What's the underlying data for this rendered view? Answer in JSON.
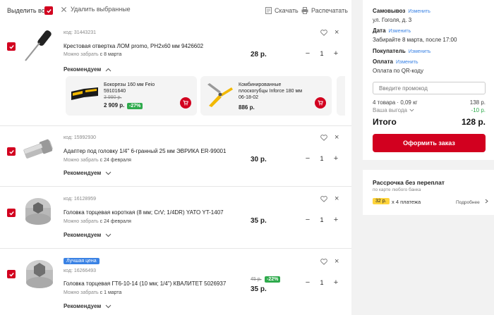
{
  "toolbar": {
    "select_all": "Выделить все",
    "delete_selected": "Удалить выбранные",
    "download": "Скачать",
    "print": "Распечатать"
  },
  "items": [
    {
      "code": "код: 31443231",
      "name": "Крестовая отвертка ЛОМ promo, PH2x60 мм 9426602",
      "pickup_prefix": "Можно забрать",
      "pickup_date": "с 8 марта",
      "price": "28 р.",
      "qty": "1",
      "recommend": "Рекомендуем"
    },
    {
      "code": "код: 15992930",
      "name": "Адаптер под головку 1/4\" 6-гранный 25 мм ЭВРИКА ER-99001",
      "pickup_prefix": "Можно забрать",
      "pickup_date": "с 24 февраля",
      "price": "30 р.",
      "qty": "1",
      "recommend": "Рекомендуем"
    },
    {
      "code": "код: 16128959",
      "name": "Головка торцевая короткая (8 мм; CrV; 1/4DR) YATO YT-1407",
      "pickup_prefix": "Можно забрать",
      "pickup_date": "с 24 февраля",
      "price": "35 р.",
      "qty": "1",
      "recommend": "Рекомендуем"
    },
    {
      "badge": "Лучшая цена",
      "code": "код: 16266493",
      "name": "Головка торцевая ГТ6-10-14 (10 мм; 1/4\") КВАЛИТЕТ 5026937",
      "pickup_prefix": "Можно забрать",
      "pickup_date": "с 1 марта",
      "old_price": "45 р.",
      "discount": "-22%",
      "price": "35 р.",
      "qty": "1",
      "recommend": "Рекомендуем"
    }
  ],
  "recommendations": [
    {
      "name": "Бокорезы 160 мм Feio 59101640",
      "old_price": "3 990 р.",
      "price": "2 909 р.",
      "discount": "-27%"
    },
    {
      "name": "Комбинированные плоскогубцы Inforce 180 мм 06-18-02",
      "price": "886 р."
    }
  ],
  "summary": {
    "pickup_label": "Самовывоз",
    "change": "Изменить",
    "pickup_address": "ул. Гоголя, д. 3",
    "date_label": "Дата",
    "date_value": "Забирайте 8 марта, после 17:00",
    "buyer_label": "Покупатель",
    "payment_label": "Оплата",
    "payment_value": "Оплата по QR-коду",
    "promo_placeholder": "Введите промокод",
    "goods_label": "4 товара · 0,09 кг",
    "goods_value": "138 р.",
    "saving_label": "Ваша выгода",
    "saving_value": "-10 р.",
    "total_label": "Итого",
    "total_value": "128 р.",
    "order_button": "Оформить заказ"
  },
  "installment": {
    "title": "Рассрочка без переплат",
    "subtitle": "по карте любого банка",
    "amount": "32 р.",
    "times": "x 4 платежа",
    "more": "Подробнее"
  },
  "colors": {
    "accent": "#d2001f",
    "link": "#3a82e4",
    "discount": "#2eaa4c",
    "panel_bg": "#f2f2f2"
  }
}
